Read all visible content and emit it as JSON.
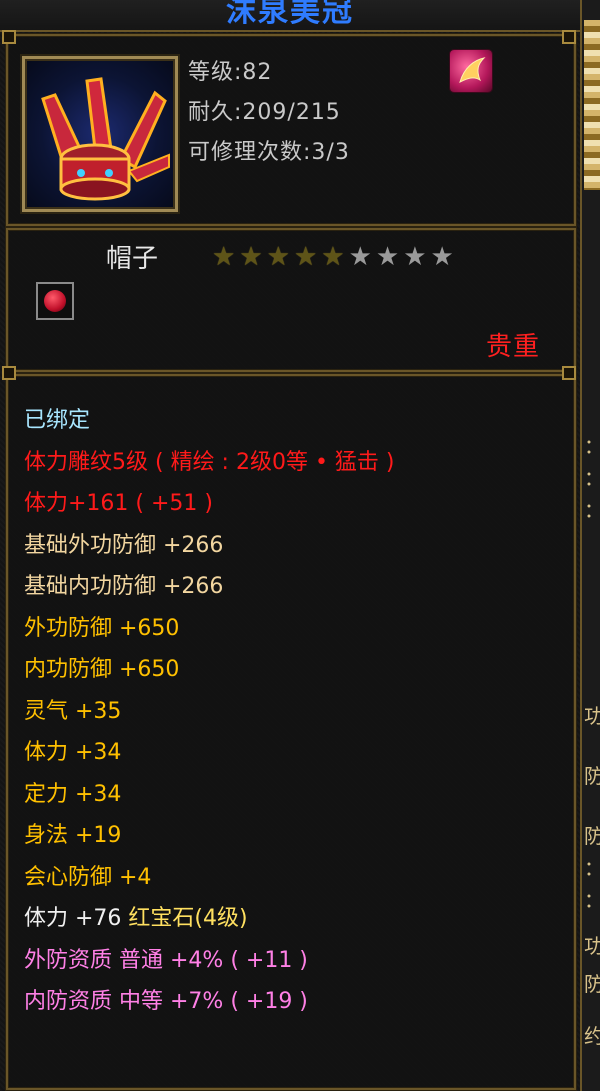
{
  "item": {
    "name": "沫泉美冠",
    "level_label": "等级:82",
    "durability_label": "耐久:209/215",
    "repair_label": "可修理次数:3/3",
    "type": "帽子",
    "rarity": "贵重",
    "stars_total": 9,
    "stars_lit": 5
  },
  "colors": {
    "title": "#2f7cff",
    "bound": "#a8e6ff",
    "red": "#ff1a1a",
    "base": "#f2d6a0",
    "gold": "#ffc000",
    "white": "#f0f0f0",
    "pink": "#ff80e6",
    "rarity": "#ff2020"
  },
  "attributes": [
    {
      "text": "已绑定",
      "color": "bound"
    },
    {
      "text": "体力雕纹5级 ( 精绘 : 2级0等 • 猛击 )",
      "color": "red"
    },
    {
      "text": "体力+161 ( +51 )",
      "color": "red"
    },
    {
      "text": "基础外功防御  +266",
      "color": "base"
    },
    {
      "text": "基础内功防御  +266",
      "color": "base"
    },
    {
      "text": "外功防御  +650",
      "color": "gold"
    },
    {
      "text": "内功防御  +650",
      "color": "gold"
    },
    {
      "text": "灵气  +35",
      "color": "gold"
    },
    {
      "text": "体力  +34",
      "color": "gold"
    },
    {
      "text": "定力  +34",
      "color": "gold"
    },
    {
      "text": "身法  +19",
      "color": "gold"
    },
    {
      "text": "会心防御  +4",
      "color": "gold"
    },
    {
      "text": "体力  +76  红宝石(4级)",
      "color": "white",
      "gem": true,
      "stat_part": "体力  +76  ",
      "gem_part": "红宝石(4级)"
    },
    {
      "text": "外防资质   普通  +4% ( +11 )",
      "color": "pink"
    },
    {
      "text": "内防资质   中等  +7% ( +19 )",
      "color": "pink"
    }
  ],
  "side_strip": {
    "chars": [
      "：",
      "：",
      "：",
      "功",
      "防",
      "防",
      "：",
      "：",
      "功",
      "防",
      "约"
    ]
  }
}
